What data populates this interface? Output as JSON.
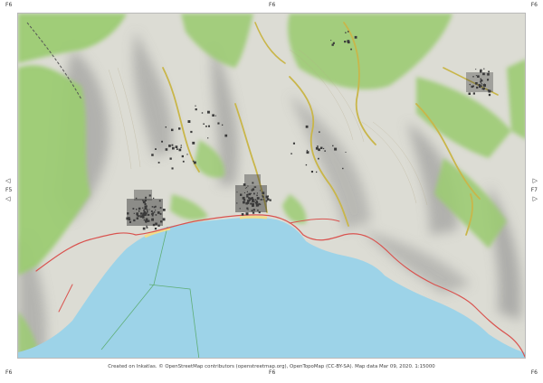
{
  "grid": {
    "top_left": "F6",
    "top_right": "F6",
    "left": "F5",
    "right": "F7",
    "bottom_left": "F6",
    "bottom_right": "F6"
  },
  "arrows": {
    "left": "◁",
    "right": "▷"
  },
  "credit": "Created on Inkatlas. © OpenStreetMap contributors (openstreetmap.org), OpenTopoMap (CC-BY-SA). Map data Mar 09, 2020. 1:15000",
  "colors": {
    "sea": "#9dd3e8",
    "land": "#dcdcd4",
    "forest": "#9ccb73",
    "shade": "#8e8e8e",
    "road": "#c9b64a",
    "trail": "#d9534f",
    "buildings": "#3a3a3a"
  }
}
